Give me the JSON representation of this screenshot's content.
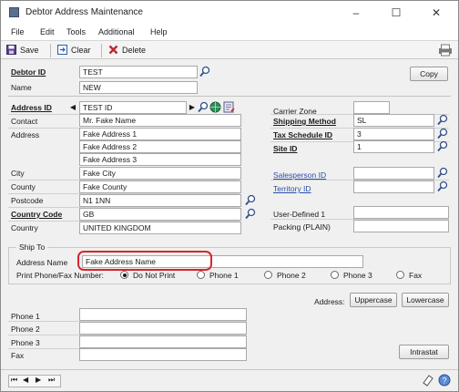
{
  "window": {
    "title": "Debtor Address Maintenance",
    "min": "–",
    "max": "☐",
    "close": "✕"
  },
  "menu": [
    "File",
    "Edit",
    "Tools",
    "Additional",
    "Help"
  ],
  "toolbar": {
    "save": "Save",
    "clear": "Clear",
    "delete": "Delete"
  },
  "header": {
    "debtor_id_label": "Debtor ID",
    "debtor_id": "TEST",
    "name_label": "Name",
    "name": "NEW",
    "copy_button": "Copy"
  },
  "address": {
    "address_id_label": "Address ID",
    "address_id": "TEST ID",
    "contact_label": "Contact",
    "contact": "Mr. Fake Name",
    "address_label": "Address",
    "lines": [
      "Fake Address 1",
      "Fake Address 2",
      "Fake Address 3"
    ],
    "city_label": "City",
    "city": "Fake City",
    "county_label": "County",
    "county": "Fake County",
    "postcode_label": "Postcode",
    "postcode": "N1 1NN",
    "country_code_label": "Country Code",
    "country_code": "GB",
    "country_label": "Country",
    "country": "UNITED KINGDOM"
  },
  "right": {
    "carrier_zone_label": "Carrier Zone",
    "carrier_zone": "",
    "shipping_method_label": "Shipping Method",
    "shipping_method": "SL",
    "tax_schedule_label": "Tax Schedule ID",
    "tax_schedule": "3",
    "site_id_label": "Site ID",
    "site_id": "1",
    "salesperson_label": "Salesperson ID",
    "salesperson": "",
    "territory_label": "Territory ID",
    "territory": "",
    "user_defined_label": "User-Defined 1",
    "user_defined": "",
    "packing_label": "Packing (PLAIN)",
    "packing": ""
  },
  "ship_to": {
    "group_label": "Ship To",
    "address_name_label": "Address Name",
    "address_name": "Fake Address Name",
    "print_label": "Print Phone/Fax Number:",
    "options": [
      "Do Not Print",
      "Phone 1",
      "Phone 2",
      "Phone 3",
      "Fax"
    ],
    "selected": "Do Not Print"
  },
  "address_case": {
    "label": "Address:",
    "uppercase": "Uppercase",
    "lowercase": "Lowercase"
  },
  "phones": {
    "phone1_label": "Phone 1",
    "phone1": "",
    "phone2_label": "Phone 2",
    "phone2": "",
    "phone3_label": "Phone 3",
    "phone3": "",
    "fax_label": "Fax",
    "fax": "",
    "intrastat_button": "Intrastat"
  },
  "colors": {
    "highlight": "#d9252a",
    "link": "#2a4ea8"
  }
}
